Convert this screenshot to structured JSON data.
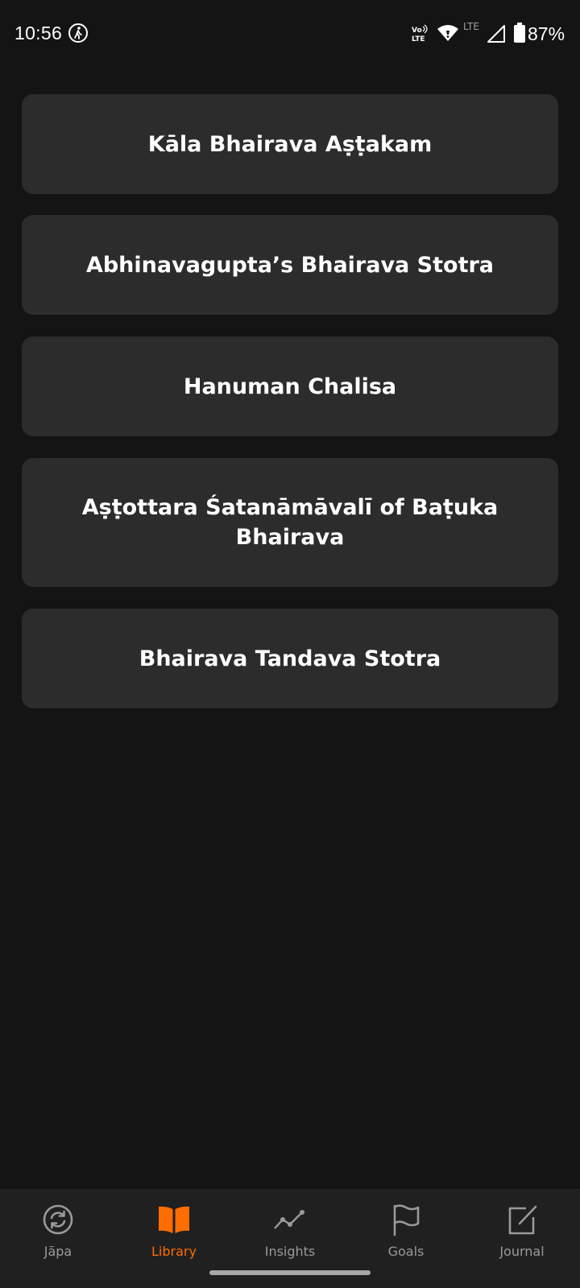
{
  "status_bar": {
    "time": "10:56",
    "network_label": "LTE",
    "battery": "87%",
    "icons": [
      "walk-icon",
      "volte-icon",
      "wifi-icon",
      "signal-icon",
      "battery-icon"
    ]
  },
  "library": {
    "items": [
      {
        "title": "Kāla Bhairava Aṣṭakam"
      },
      {
        "title": "Abhinavagupta’s Bhairava Stotra"
      },
      {
        "title": "Hanuman Chalisa"
      },
      {
        "title": "Aṣṭottara Śatanāmāvalī of Baṭuka Bhairava"
      },
      {
        "title": "Bhairava Tandava Stotra"
      }
    ]
  },
  "bottom_nav": {
    "active_tab": "Library",
    "items": [
      {
        "label": "Jāpa",
        "icon": "refresh-circle-icon"
      },
      {
        "label": "Library",
        "icon": "book-icon"
      },
      {
        "label": "Insights",
        "icon": "line-graph-icon"
      },
      {
        "label": "Goals",
        "icon": "flag-icon"
      },
      {
        "label": "Journal",
        "icon": "edit-note-icon"
      }
    ]
  },
  "colors": {
    "background": "#141414",
    "card": "#2c2c2c",
    "nav_background": "#202020",
    "accent": "#ff6d00",
    "inactive": "#9a9a9a"
  }
}
